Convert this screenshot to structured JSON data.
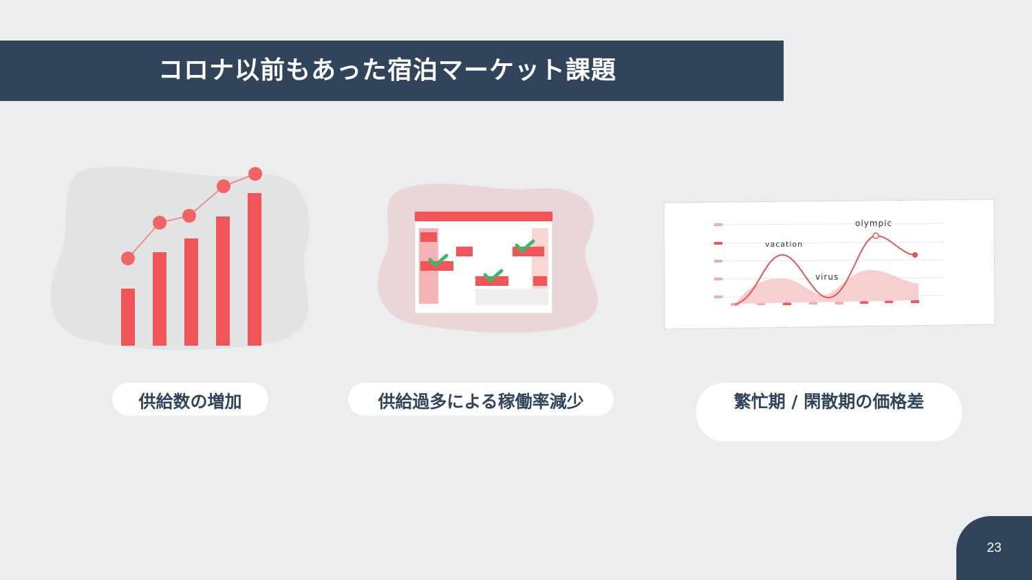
{
  "slide": {
    "title": "コロナ以前もあった宿泊マーケット課題",
    "page_number": "23"
  },
  "items": [
    {
      "caption": "供給数の増加",
      "icon": "rising-bar-chart-icon"
    },
    {
      "caption": "供給過多による稼働率減少",
      "icon": "booking-calendar-icon"
    },
    {
      "caption": "繁忙期 / 閑散期の価格差",
      "icon": "seasonal-price-graph-icon"
    }
  ],
  "seasonal_graph_labels": {
    "peak1": "vacation",
    "trough": "virus",
    "peak2": "olympic"
  },
  "colors": {
    "navy": "#30455b",
    "accent_red": "#f25557",
    "check_green": "#3db86a",
    "background": "#ecedef"
  }
}
